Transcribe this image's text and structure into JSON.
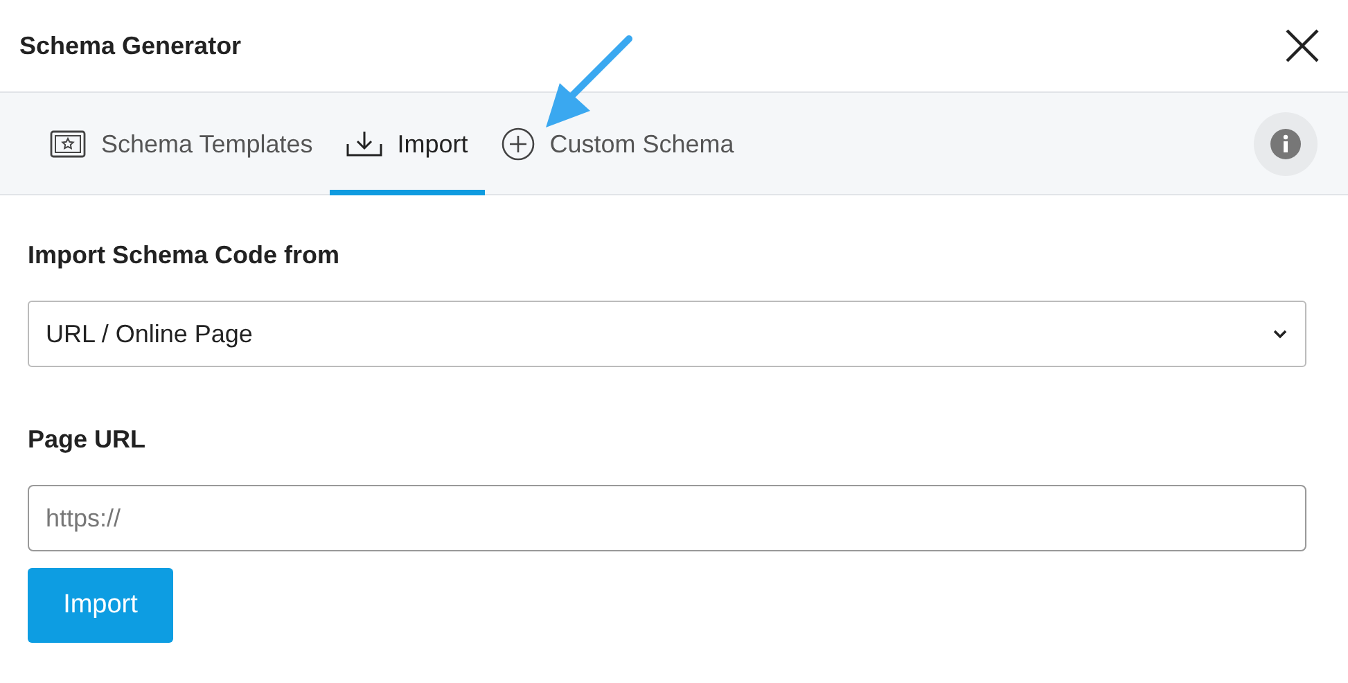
{
  "window": {
    "title": "Schema Generator"
  },
  "tabs": [
    {
      "label": "Schema Templates",
      "kind": "templates",
      "selected": false
    },
    {
      "label": "Import",
      "kind": "import",
      "selected": true
    },
    {
      "label": "Custom Schema",
      "kind": "custom",
      "selected": false
    }
  ],
  "form": {
    "source_label": "Import Schema Code from",
    "source_select": {
      "value": "URL / Online Page"
    },
    "url_label": "Page URL",
    "url_field": {
      "placeholder": "https://"
    },
    "import_button": "Import"
  }
}
